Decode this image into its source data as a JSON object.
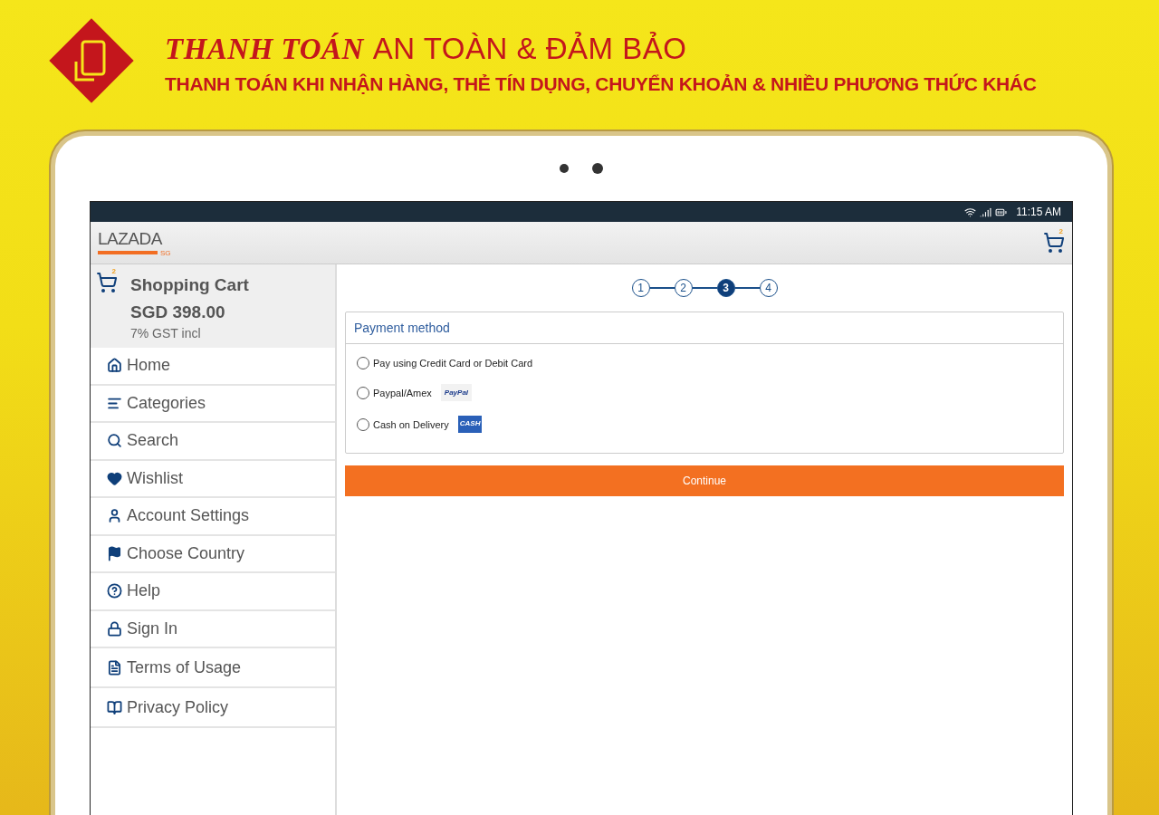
{
  "banner": {
    "title_emphasis": "THANH TOÁN",
    "title_rest": "AN TOÀN & ĐẢM BẢO",
    "subtitle": "THANH TOÁN KHI NHẬN HÀNG, THẺ TÍN DỤNG, CHUYỂN KHOẢN & NHIỀU PHƯƠNG THỨC KHÁC"
  },
  "status_bar": {
    "time": "11:15 AM"
  },
  "app_bar": {
    "logo": "LAZADA",
    "logo_region": "SG",
    "cart_count": "2"
  },
  "cart_summary": {
    "cart_count": "2",
    "title": "Shopping Cart",
    "total": "SGD 398.00",
    "tax_note": "7% GST incl"
  },
  "sidebar": {
    "items": [
      {
        "kind": "home",
        "label": "Home"
      },
      {
        "kind": "categories",
        "label": "Categories"
      },
      {
        "kind": "search",
        "label": "Search"
      },
      {
        "kind": "wishlist",
        "label": "Wishlist"
      },
      {
        "kind": "account",
        "label": "Account Settings"
      },
      {
        "kind": "country",
        "label": "Choose Country"
      },
      {
        "kind": "help",
        "label": "Help"
      },
      {
        "kind": "signin",
        "label": "Sign In"
      },
      {
        "kind": "terms",
        "label": "Terms of Usage"
      },
      {
        "kind": "privacy",
        "label": "Privacy Policy"
      }
    ]
  },
  "steps": [
    {
      "label": "1",
      "selected": false
    },
    {
      "label": "2",
      "selected": false
    },
    {
      "label": "3",
      "selected": true
    },
    {
      "label": "4",
      "selected": false
    }
  ],
  "payment": {
    "title": "Payment method",
    "options": [
      {
        "kind": "plain",
        "label": "Pay using Credit Card or Debit Card",
        "selected": false
      },
      {
        "kind": "paypal",
        "label": "Paypal/Amex",
        "selected": false,
        "logo_text": "PayPal"
      },
      {
        "kind": "cash",
        "label": "Cash on Delivery",
        "selected": false,
        "logo_text": "CASH"
      }
    ]
  },
  "continue_button": "Continue"
}
